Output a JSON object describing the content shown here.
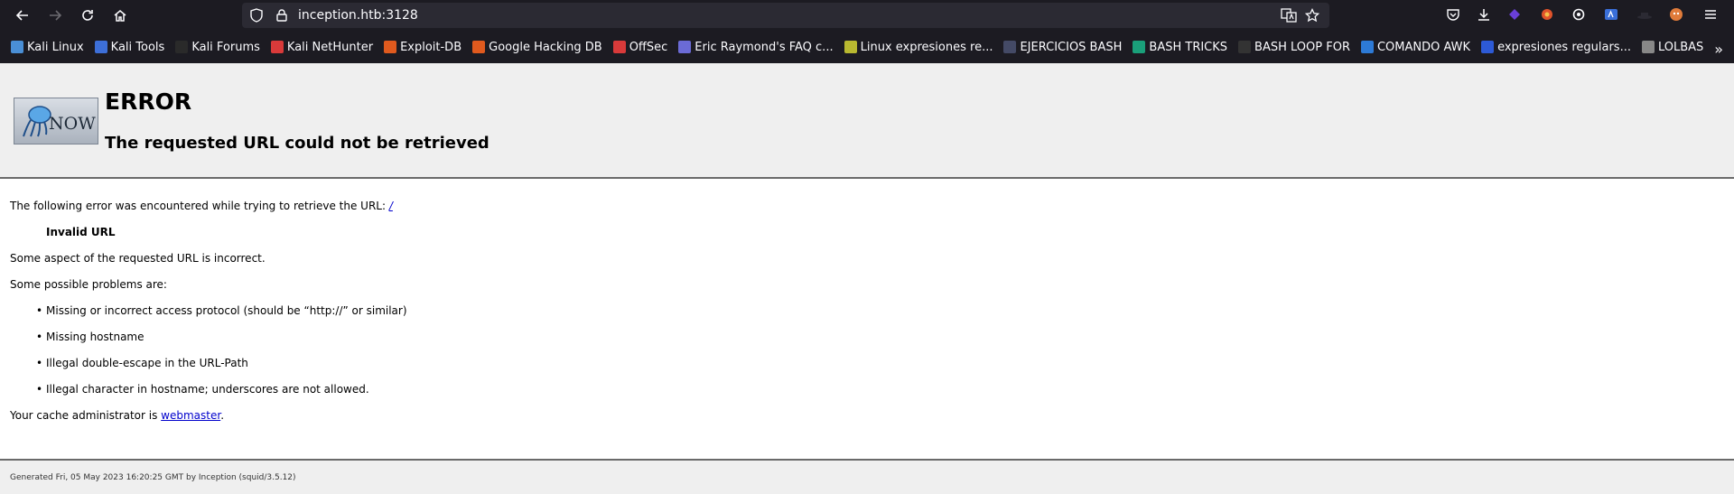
{
  "browser": {
    "url": "inception.htb:3128",
    "bookmarks": [
      {
        "label": "Kali Linux",
        "color": "#4a8fd6"
      },
      {
        "label": "Kali Tools",
        "color": "#3d6fd8"
      },
      {
        "label": "Kali Forums",
        "color": "#2a2a2a"
      },
      {
        "label": "Kali NetHunter",
        "color": "#d93a3a"
      },
      {
        "label": "Exploit-DB",
        "color": "#e05a1e"
      },
      {
        "label": "Google Hacking DB",
        "color": "#e05a1e"
      },
      {
        "label": "OffSec",
        "color": "#d93a3a"
      },
      {
        "label": "Eric Raymond's FAQ c...",
        "color": "#6b6bd6"
      },
      {
        "label": "Linux expresiones re...",
        "color": "#b8b830"
      },
      {
        "label": "EJERCICIOS BASH",
        "color": "#444a66"
      },
      {
        "label": "BASH TRICKS",
        "color": "#1aa07a"
      },
      {
        "label": "BASH LOOP FOR",
        "color": "#333333"
      },
      {
        "label": "COMANDO AWK",
        "color": "#2d7ad6"
      },
      {
        "label": "expresiones regulars...",
        "color": "#2d5ad6"
      },
      {
        "label": "LOLBAS",
        "color": "#888888"
      }
    ],
    "bookmarks_more": "»"
  },
  "page": {
    "title": "ERROR",
    "subtitle": "The requested URL could not be retrieved",
    "logo_text": "NOW",
    "intro": "The following error was encountered while trying to retrieve the URL: ",
    "intro_link": "/",
    "error_name": "Invalid URL",
    "description": "Some aspect of the requested URL is incorrect.",
    "problems_heading": "Some possible problems are:",
    "problems": [
      "Missing or incorrect access protocol (should be “http://” or similar)",
      "Missing hostname",
      "Illegal double-escape in the URL-Path",
      "Illegal character in hostname; underscores are not allowed."
    ],
    "admin_prefix": "Your cache administrator is ",
    "admin_link": "webmaster",
    "admin_suffix": ".",
    "footer": "Generated Fri, 05 May 2023 16:20:25 GMT by Inception (squid/3.5.12)"
  }
}
